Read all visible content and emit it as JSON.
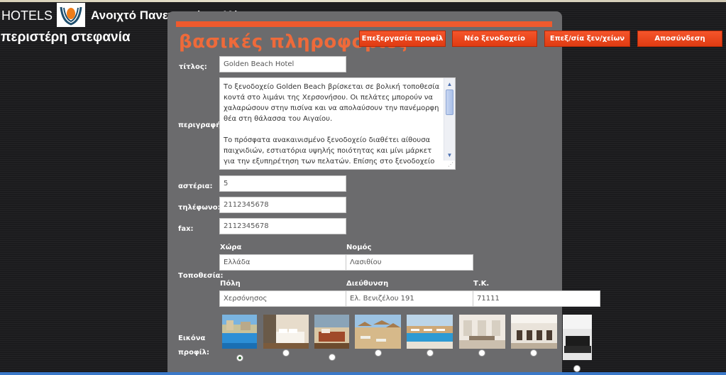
{
  "header": {
    "site": "HOTELS",
    "university": "Ανοιχτό Πανεπιστήμιο Κύπρου",
    "user": "περιστέρη στεφανία"
  },
  "section_title": "βασικές πληροφορίες",
  "nav": {
    "edit_profile": "Επεξεργασία προφίλ",
    "new_hotel": "Νέο ξενοδοχείο",
    "edit_hotels": "Επεξ/σία ξεν/χείων",
    "logout": "Αποσύνδεση"
  },
  "form": {
    "title_label": "τίτλος:",
    "title_value": "Golden Beach Hotel",
    "description_label": "περιγραφή:",
    "description_p1": "Το ξενοδοχείο Golden Beach βρίσκεται σε βολική τοποθεσία κοντά στο λιμάνι της Χερσονήσου. Οι πελάτες μπορούν να χαλαρώσουν στην πισίνα και να απολαύσουν την πανέμορφη θέα στη θάλασσα του Αιγαίου.",
    "description_p2": "Το πρόσφατα ανακαινισμένο ξενοδοχείο διαθέτει αίθουσα παιχνιδιών, εστιατόρια υψηλής ποιότητας και μίνι μάρκετ για την εξυπηρέτηση των πελατών. Επίσης στο ξενοδοχείο μπορεί να",
    "stars_label": "αστέρια:",
    "stars_value": "5",
    "phone_label": "τηλέφωνο:",
    "phone_value": "2112345678",
    "fax_label": "fax:",
    "fax_value": "2112345678",
    "location_label": "Τοποθεσία:",
    "country_label": "Χώρα",
    "country_value": "Ελλάδα",
    "prefecture_label": "Νομός",
    "prefecture_value": "Λασιθίου",
    "city_label": "Πόλη",
    "city_value": "Χερσόνησος",
    "address_label": "Διεύθυνση",
    "address_value": "Ελ. Βενιζέλου 191",
    "postal_label": "Τ.Κ.",
    "postal_value": "71111",
    "image_label_1": "Εικόνα",
    "image_label_2": "προφίλ:"
  },
  "profile_images": [
    {
      "name": "pool-view",
      "selected": true
    },
    {
      "name": "bedroom-1",
      "selected": false
    },
    {
      "name": "bedroom-2",
      "selected": false
    },
    {
      "name": "beach-umbrellas",
      "selected": false
    },
    {
      "name": "pool-loungers",
      "selected": false
    },
    {
      "name": "lobby-1",
      "selected": false
    },
    {
      "name": "lobby-2",
      "selected": false
    },
    {
      "name": "lounge-sofa",
      "selected": false
    }
  ],
  "colors": {
    "accent": "#ee5a2e",
    "panel": "#6b6b6d",
    "background": "#1b1b1d"
  }
}
